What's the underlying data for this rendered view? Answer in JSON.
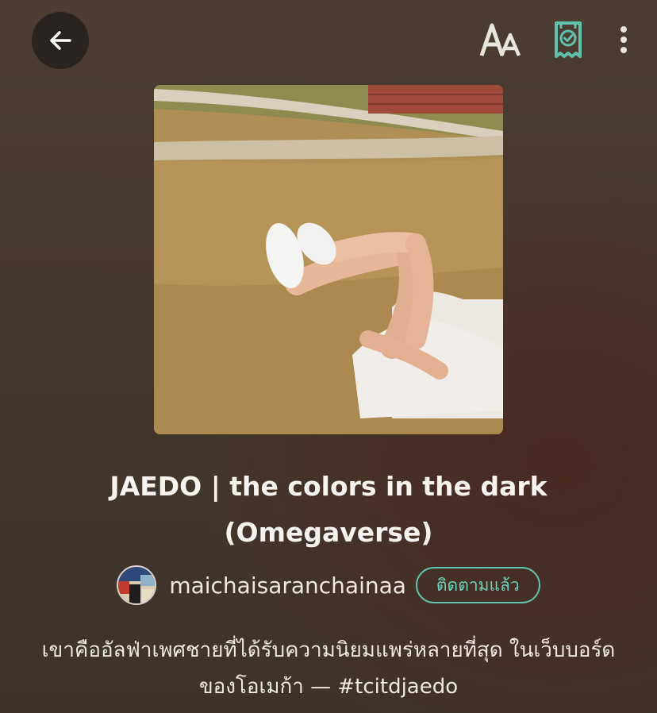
{
  "header": {
    "back_icon": "arrow-left-icon",
    "font_size_icon": "font-size-icon",
    "badge_icon": "verified-ticket-icon",
    "more_icon": "more-vertical-icon",
    "accent": "#5fc2ad"
  },
  "story": {
    "title": "JAEDO | the colors in the dark (Omegaverse)",
    "author": "maichaisaranchainaa",
    "follow_label": "ติดตามแล้ว",
    "description": "เขาคืออัลฟ่าเพศชายที่ได้รับความนิยมแพร่หลายที่สุด ในเว็บบอร์ดของโอเมก้า — #tcitdjaedo"
  }
}
